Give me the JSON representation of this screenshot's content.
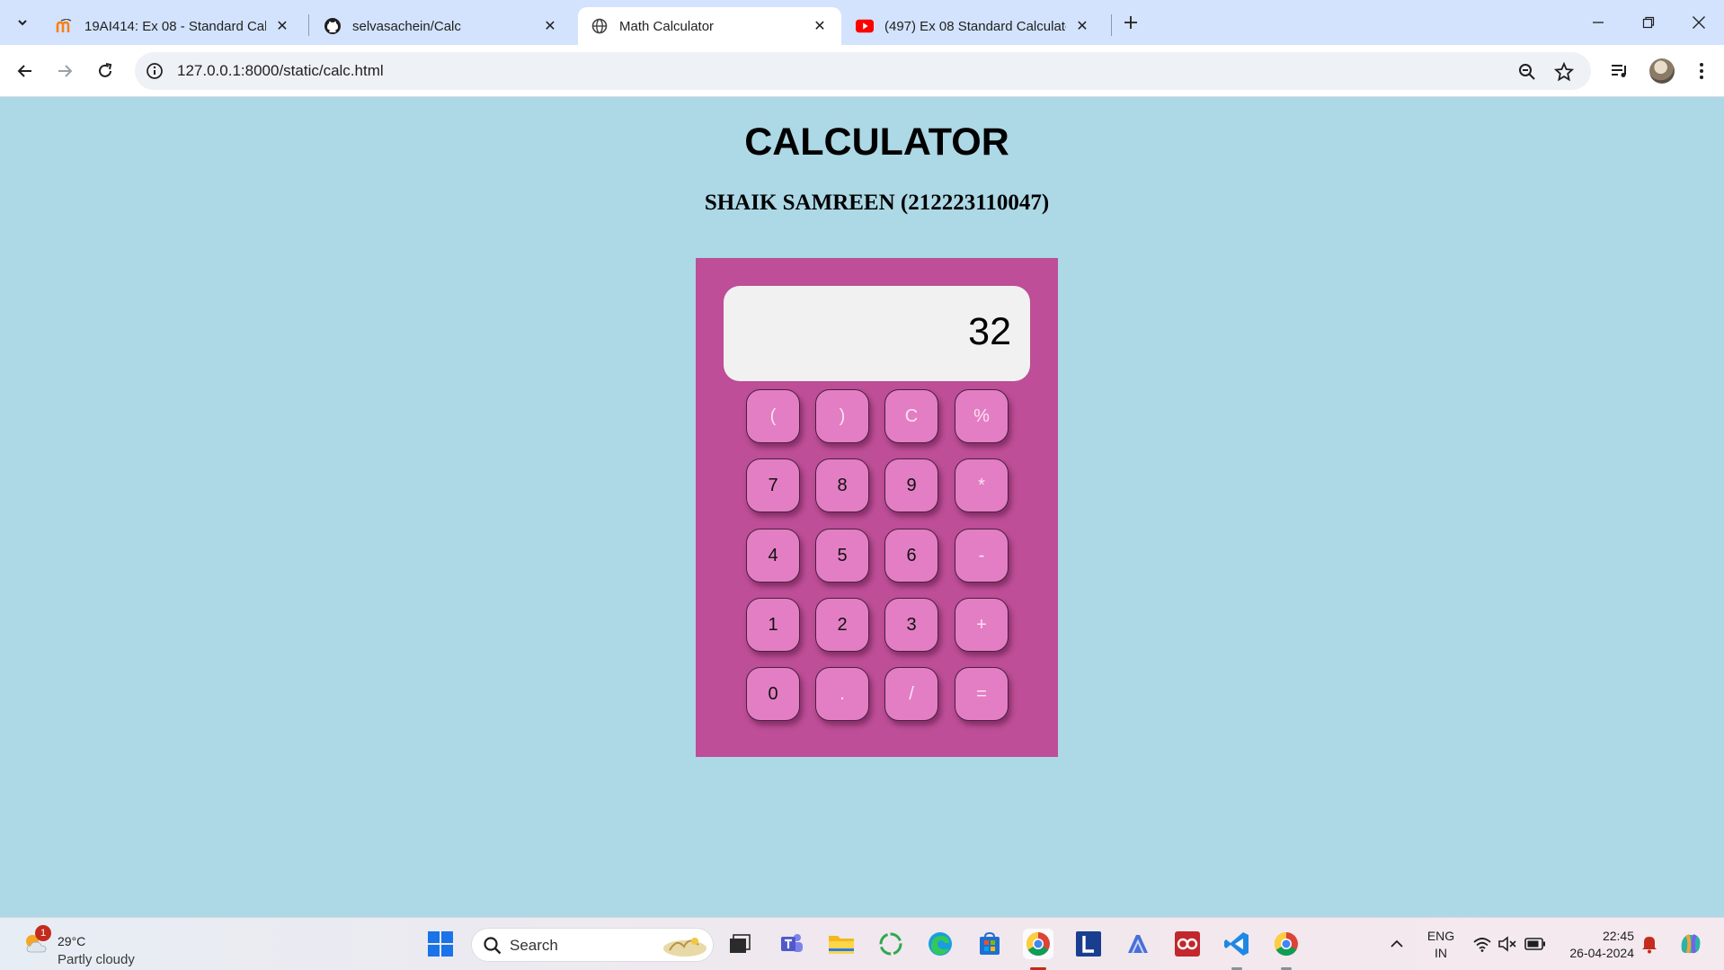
{
  "browser": {
    "tabs": [
      {
        "title": "19AI414: Ex 08 - Standard Calcu",
        "favicon": "moodle-icon",
        "active": false
      },
      {
        "title": "selvasachein/Calc",
        "favicon": "github-icon",
        "active": false
      },
      {
        "title": "Math Calculator",
        "favicon": "globe-icon",
        "active": true
      },
      {
        "title": "(497) Ex 08 Standard Calculator",
        "favicon": "youtube-icon",
        "active": false
      }
    ],
    "url": "127.0.0.1:8000/static/calc.html"
  },
  "page": {
    "heading": "CALCULATOR",
    "subheading": "SHAIK SAMREEN (212223110047)"
  },
  "calculator": {
    "display": "32",
    "keys": [
      "(",
      ")",
      "C",
      "%",
      "7",
      "8",
      "9",
      "*",
      "4",
      "5",
      "6",
      "-",
      "1",
      "2",
      "3",
      "+",
      "0",
      ".",
      "/",
      "="
    ],
    "colors": {
      "body": "#bd4e97",
      "key": "#e37ec4",
      "display": "#f1f1f1",
      "page": "#add8e6"
    }
  },
  "taskbar": {
    "weather_temp": "29°C",
    "weather_condition": "Partly cloudy",
    "weather_badge": "1",
    "search_label": "Search",
    "lang_line1": "ENG",
    "lang_line2": "IN",
    "time": "22:45",
    "date": "26-04-2024"
  }
}
